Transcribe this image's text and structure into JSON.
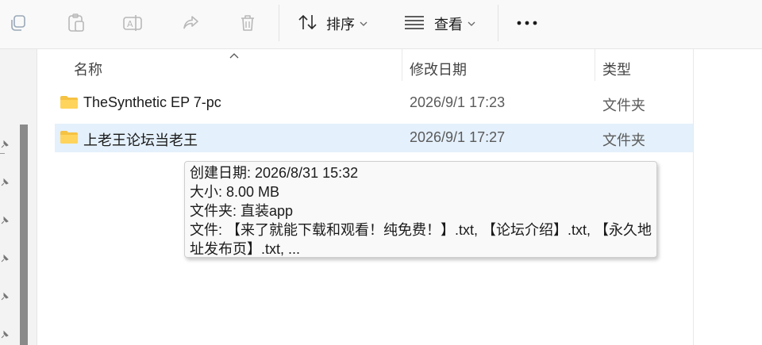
{
  "toolbar": {
    "sort_label": "排序",
    "view_label": "查看",
    "icons": [
      "copy-icon",
      "paste-icon",
      "rename-icon",
      "share-icon",
      "delete-icon",
      "sort-icon",
      "view-icon",
      "more-icon"
    ]
  },
  "columns": {
    "name": "名称",
    "modified": "修改日期",
    "type": "类型"
  },
  "files": [
    {
      "name": "TheSynthetic EP 7-pc",
      "modified": "2026/9/1 17:23",
      "type": "文件夹"
    },
    {
      "name": "上老王论坛当老王",
      "modified": "2026/9/1 17:27",
      "type": "文件夹"
    }
  ],
  "tooltip": {
    "created": "创建日期: 2026/8/31 15:32",
    "size": "大小: 8.00 MB",
    "folders": "文件夹: 直装app",
    "files_line1": "文件: 【来了就能下载和观看！纯免费！】.txt, 【论坛介绍】.txt, 【永久地",
    "files_line2": "址发布页】.txt, ..."
  },
  "colors": {
    "folder": "#f5c242",
    "selected_row": "#e4f0fb",
    "nav_background": "#f3f3f3"
  }
}
